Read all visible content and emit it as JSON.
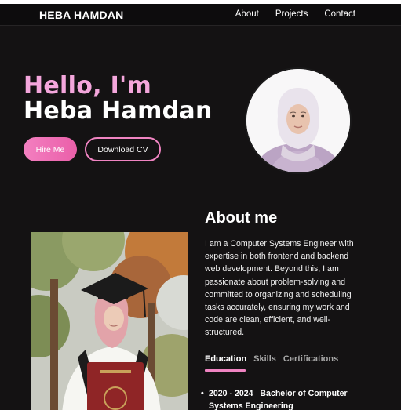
{
  "brand": "HEBA HAMDAN",
  "nav": [
    "About",
    "Projects",
    "Contact"
  ],
  "hero": {
    "greeting": "Hello, I'm",
    "name": "Heba Hamdan",
    "hire_label": "Hire Me",
    "cv_label": "Download CV"
  },
  "about": {
    "title": "About me",
    "text": "I am a Computer Systems Engineer with expertise in both frontend and backend web development. Beyond this, I am passionate about problem-solving and committed to organizing and scheduling tasks accurately, ensuring my work and code are clean, efficient, and well-structured."
  },
  "tabs": [
    "Education",
    "Skills",
    "Certifications"
  ],
  "education": [
    {
      "years": "2020 - 2024",
      "degree": "Bachelor of Computer Systems Engineering"
    }
  ],
  "colors": {
    "accent": "#f084c2",
    "background": "#141213",
    "header": "#0d0c0d"
  }
}
